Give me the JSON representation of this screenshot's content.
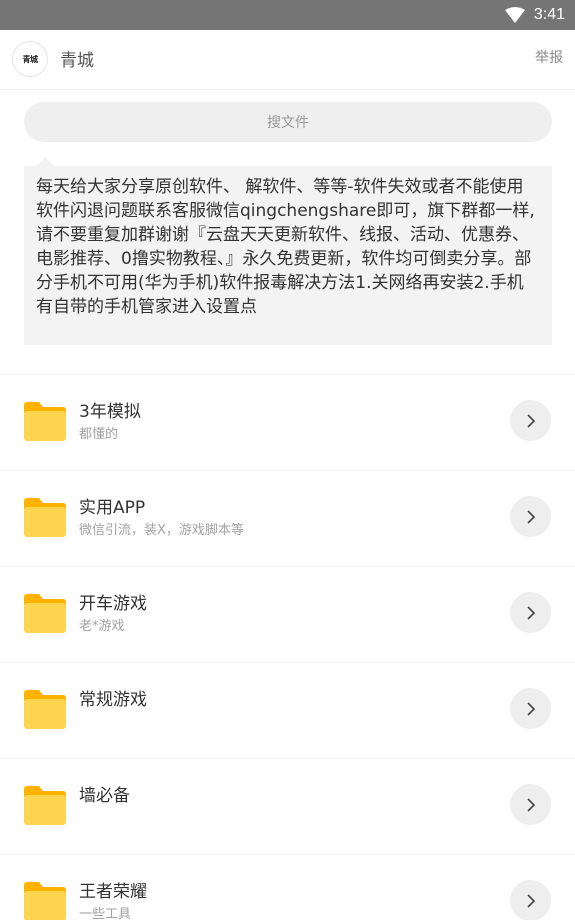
{
  "status_bar": {
    "time": "3:41"
  },
  "header": {
    "avatar_text": "青城",
    "title": "青城",
    "report_label": "举报"
  },
  "search": {
    "placeholder": "搜文件"
  },
  "notice": {
    "text": "每天给大家分享原创软件、 解软件、等等-软件失效或者不能使用软件闪退问题联系客服微信qingchengshare即可，旗下群都一样,请不要重复加群谢谢『云盘天天更新软件、线报、活动、优惠券、电影推荐、0撸实物教程、』永久免费更新，软件均可倒卖分享。部分手机不可用(华为手机)软件报毒解决方法1.关网络再安装2.手机有自带的手机管家进入设置点"
  },
  "folders": [
    {
      "name": "3年模拟",
      "desc": "都懂的"
    },
    {
      "name": "实用APP",
      "desc": "微信引流，装X，游戏脚本等"
    },
    {
      "name": "开车游戏",
      "desc": "老*游戏"
    },
    {
      "name": "常规游戏",
      "desc": ""
    },
    {
      "name": "墙必备",
      "desc": ""
    },
    {
      "name": "王者荣耀",
      "desc": "一些工具"
    }
  ],
  "colors": {
    "status_bar": "#757575",
    "folder_body": "#FFD54F",
    "folder_tab": "#FFB300",
    "arrow_bg": "#EEEEEE"
  }
}
